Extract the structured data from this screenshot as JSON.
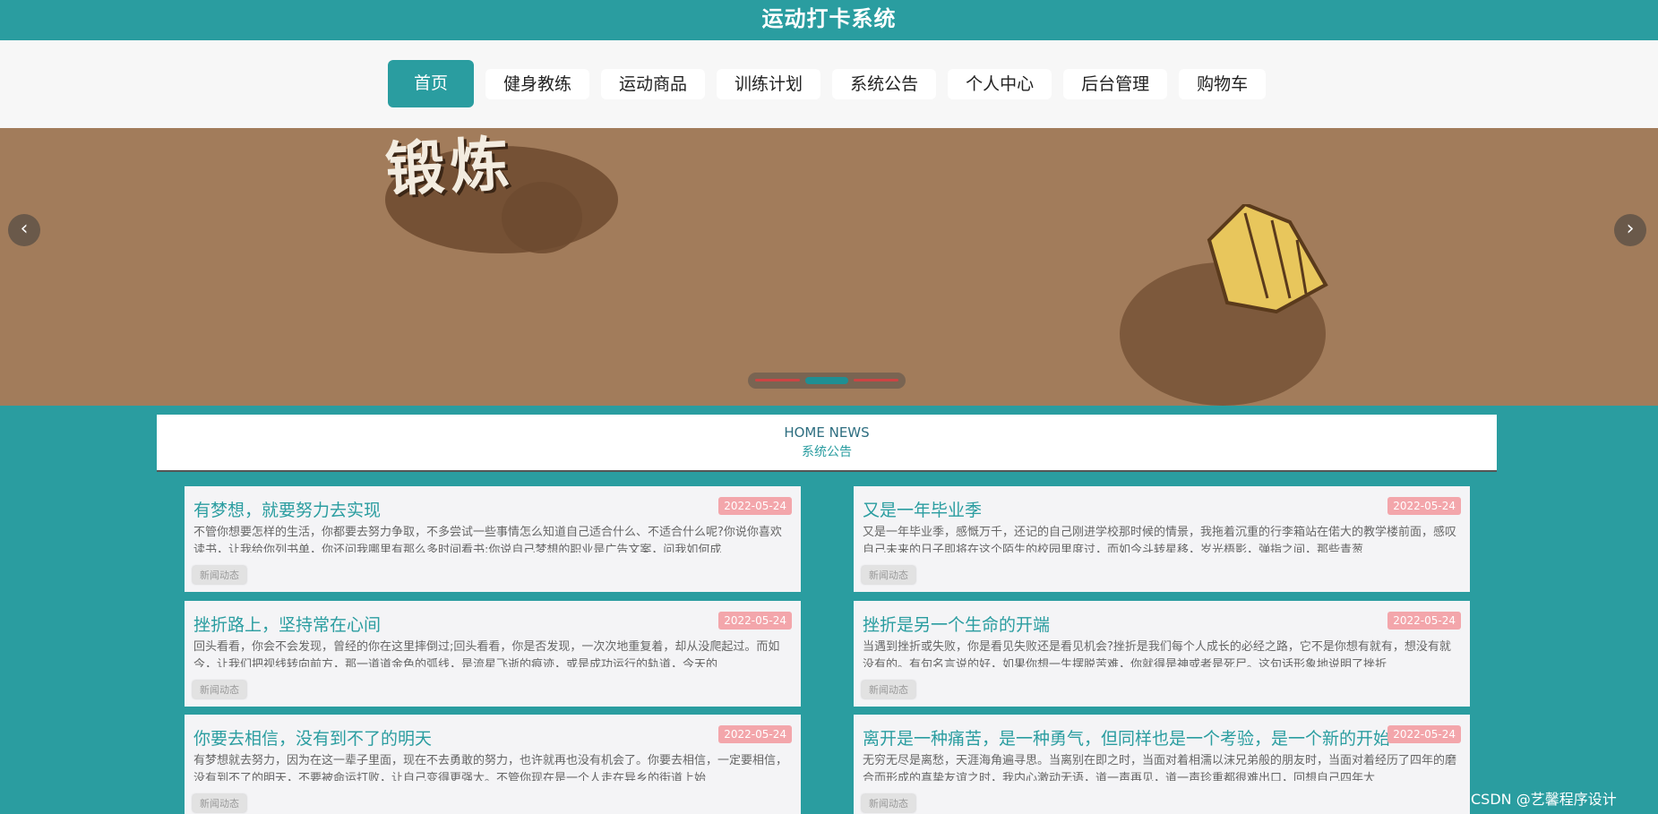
{
  "app": {
    "title": "运动打卡系统"
  },
  "nav": {
    "items": [
      "首页",
      "健身教练",
      "运动商品",
      "训练计划",
      "系统公告",
      "个人中心",
      "后台管理",
      "购物车"
    ],
    "active_index": 0
  },
  "banner": {
    "text": "锻炼",
    "prev_icon": "chevron-left-icon",
    "next_icon": "chevron-right-icon",
    "slide_count": 3,
    "active_slide": 1
  },
  "news": {
    "heading_en": "HOME NEWS",
    "heading_cn": "系统公告",
    "tag": "新闻动态",
    "items": [
      {
        "title": "有梦想，就要努力去实现",
        "date": "2022-05-24",
        "summary": "不管你想要怎样的生活，你都要去努力争取，不多尝试一些事情怎么知道自己适合什么、不适合什么呢?你说你喜欢读书，让我给你列书单，你还问我哪里有那么多时间看书;你说自己梦想的职业是广告文案，问我如何成"
      },
      {
        "title": "又是一年毕业季",
        "date": "2022-05-24",
        "summary": "又是一年毕业季，感慨万千，还记的自己刚进学校那时候的情景，我拖着沉重的行李箱站在偌大的教学楼前面，感叹自己未来的日子即将在这个陌生的校园里度过，而如今斗转星移，岁光梧影，弹指之间，那些青葱"
      },
      {
        "title": "挫折路上，坚持常在心间",
        "date": "2022-05-24",
        "summary": "回头看看，你会不会发现，曾经的你在这里摔倒过;回头看看，你是否发现，一次次地重复着，却从没爬起过。而如今，让我们把视线转向前方，那一道道金色的弧线，是流星飞逝的痕迹，或是成功运行的轨道，今天的"
      },
      {
        "title": "挫折是另一个生命的开端",
        "date": "2022-05-24",
        "summary": "当遇到挫折或失败，你是看见失败还是看见机会?挫折是我们每个人成长的必经之路，它不是你想有就有，想没有就没有的。有句名言说的好，如果你想一生摆脱苦难，你就得是神或者是死尸。这句话形象地说明了挫折"
      },
      {
        "title": "你要去相信，没有到不了的明天",
        "date": "2022-05-24",
        "summary": "有梦想就去努力，因为在这一辈子里面，现在不去勇敢的努力，也许就再也没有机会了。你要去相信，一定要相信，没有到不了的明天，不要被命运打败，让自己变得更强大。不管你现在是一个人走在异乡的街道上始"
      },
      {
        "title": "离开是一种痛苦，是一种勇气，但同样也是一个考验，是一个新的开始",
        "date": "2022-05-24",
        "summary": "无穷无尽是离愁，天涯海角遍寻思。当离别在即之时，当面对着相濡以沫兄弟般的朋友时，当面对着经历了四年的磨合而形成的真挚友谊之时，我内心激动无语，道一声再见，道一声珍重都很难出口，回想自己四年大"
      }
    ]
  },
  "watermark": "CSDN @艺馨程序设计"
}
